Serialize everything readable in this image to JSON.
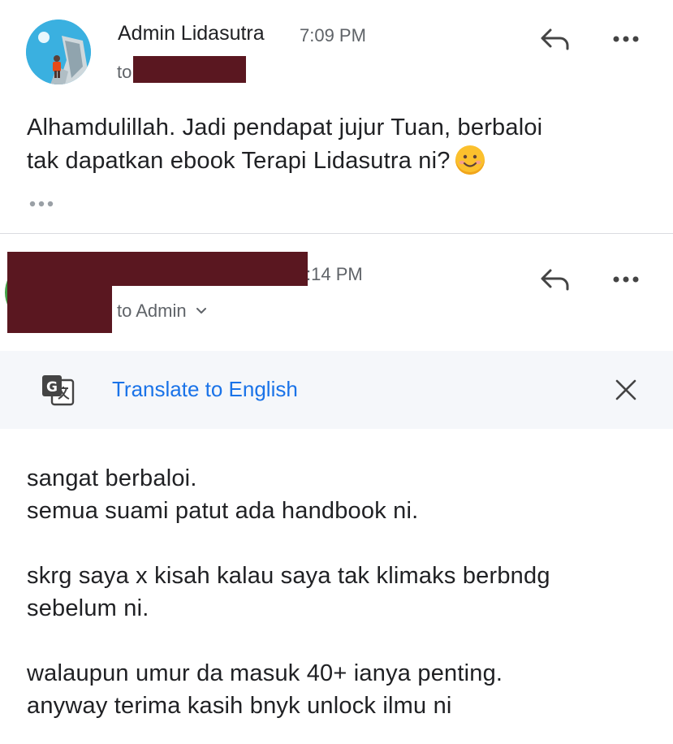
{
  "message1": {
    "sender": "Admin Lidasutra",
    "time": "7:09 PM",
    "to_prefix": "to",
    "body_line1": "Alhamdulillah. Jadi pendapat jujur Tuan, berbaloi",
    "body_line2": "tak dapatkan ebook Terapi Lidasutra ni?",
    "emoji_icon": "smiling-face-icon",
    "expand_icon": "more-horizontal-icon"
  },
  "message2": {
    "time_partial": ":14 PM",
    "recipient": "to Admin",
    "translate_label": "Translate to English",
    "lines": [
      "sangat berbaloi.",
      "semua suami patut ada handbook ni.",
      "",
      "skrg saya x kisah kalau saya tak klimaks berbndg",
      "sebelum ni.",
      "",
      "walaupun umur da masuk 40+ ianya penting.",
      "anyway terima kasih bnyk unlock ilmu ni"
    ]
  },
  "icons": {
    "reply": "reply-icon",
    "more": "more-vertical-icon",
    "translate": "google-translate-icon",
    "close": "close-icon",
    "chevron": "chevron-down-icon"
  },
  "colors": {
    "link": "#1a73e8",
    "redaction": "#5a1720",
    "translate_bar_bg": "#f5f7fa",
    "avatar_bg": "#3ab0e0"
  }
}
